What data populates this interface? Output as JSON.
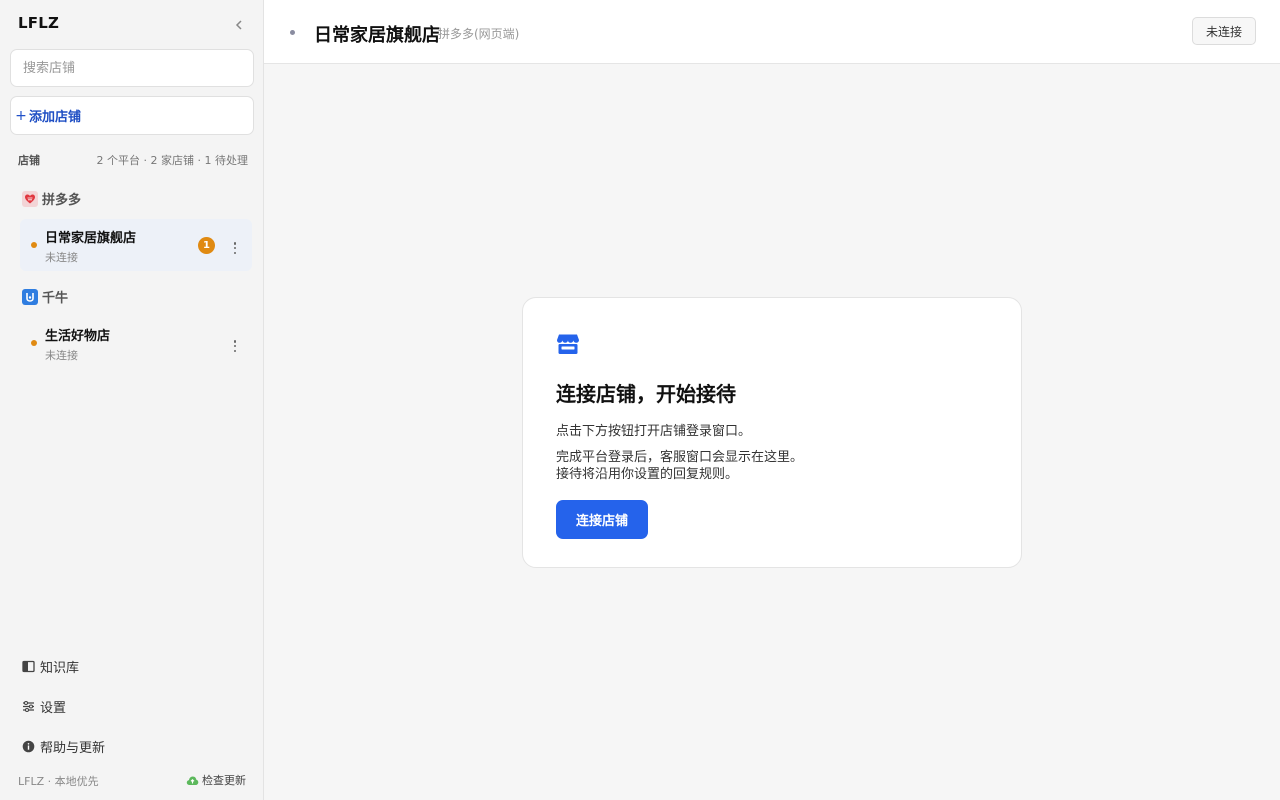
{
  "app": {
    "brand": "LFLZ"
  },
  "sidebar": {
    "search_placeholder": "搜索店铺",
    "add_store_label": "添加店铺",
    "section_title": "店铺",
    "section_stats": "2 个平台 · 2 家店铺 · 1 待处理",
    "platforms": [
      {
        "name": "拼多多",
        "icon": "pinduoduo-logo-icon",
        "stores": [
          {
            "name": "日常家居旗舰店",
            "status": "未连接",
            "badge": "1",
            "active": true
          }
        ]
      },
      {
        "name": "千牛",
        "icon": "qianniu-logo-icon",
        "stores": [
          {
            "name": "生活好物店",
            "status": "未连接",
            "badge": "",
            "active": false
          }
        ]
      }
    ],
    "nav": [
      {
        "label": "知识库",
        "icon": "book-icon"
      },
      {
        "label": "设置",
        "icon": "sliders-icon"
      },
      {
        "label": "帮助与更新",
        "icon": "info-icon"
      }
    ],
    "footer_brand": "LFLZ · 本地优先",
    "check_update_label": "检查更新"
  },
  "header": {
    "title": "日常家居旗舰店",
    "subtitle": "拼多多(网页端)",
    "status": "未连接"
  },
  "card": {
    "title": "连接店铺，开始接待",
    "desc1": "点击下方按钮打开店铺登录窗口。",
    "desc2_line1": "完成平台登录后，客服窗口会显示在这里。",
    "desc2_line2": "接待将沿用你设置的回复规则。",
    "button_label": "连接店铺"
  },
  "colors": {
    "accent": "#2563eb",
    "pending": "#e08a12",
    "link": "#1f4fc4"
  }
}
